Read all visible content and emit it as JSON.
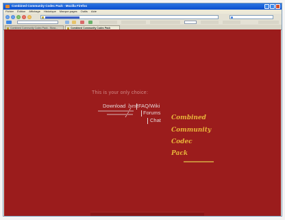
{
  "window": {
    "title": "Combined Community Codec Pack - Mozilla Firefox"
  },
  "menubar": [
    "Fichier",
    "Édition",
    "Affichage",
    "Historique",
    "Marque-pages",
    "Outils",
    "Aide"
  ],
  "tabs": [
    {
      "label": "Combined Community Codec Pack - Stora...",
      "active": false
    },
    {
      "label": "Combined Community Codec Pack",
      "active": true
    }
  ],
  "page": {
    "slogan": "This is your only choice:",
    "scrawl": "best",
    "links": {
      "download": "Download",
      "faq": "FAQ/Wiki",
      "forums": "Forums",
      "chat": "Chat"
    },
    "logo": [
      "Combined",
      "Community",
      "Codec",
      "Pack"
    ],
    "colors": {
      "background": "#9b1c1c",
      "logo": "#e8b43a",
      "link": "#e6d8d8"
    }
  }
}
